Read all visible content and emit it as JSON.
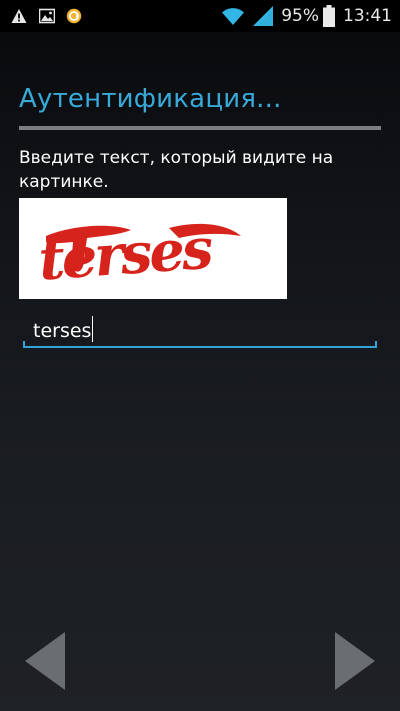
{
  "status_bar": {
    "battery_percent": "95%",
    "time": "13:41",
    "icons": [
      "warning-icon",
      "image-icon",
      "app-notification-icon",
      "wifi-icon",
      "signal-icon",
      "battery-icon"
    ]
  },
  "page": {
    "title": "Аутентификация...",
    "instruction": "Введите текст, который видите на картинке.",
    "captcha_text": "terses"
  },
  "input": {
    "value": "terses"
  },
  "navigation": {
    "prev": "back-arrow-icon",
    "next": "forward-arrow-icon"
  },
  "colors": {
    "accent": "#39a9d8",
    "captcha_red": "#d6231c",
    "divider": "#7b7d80"
  }
}
